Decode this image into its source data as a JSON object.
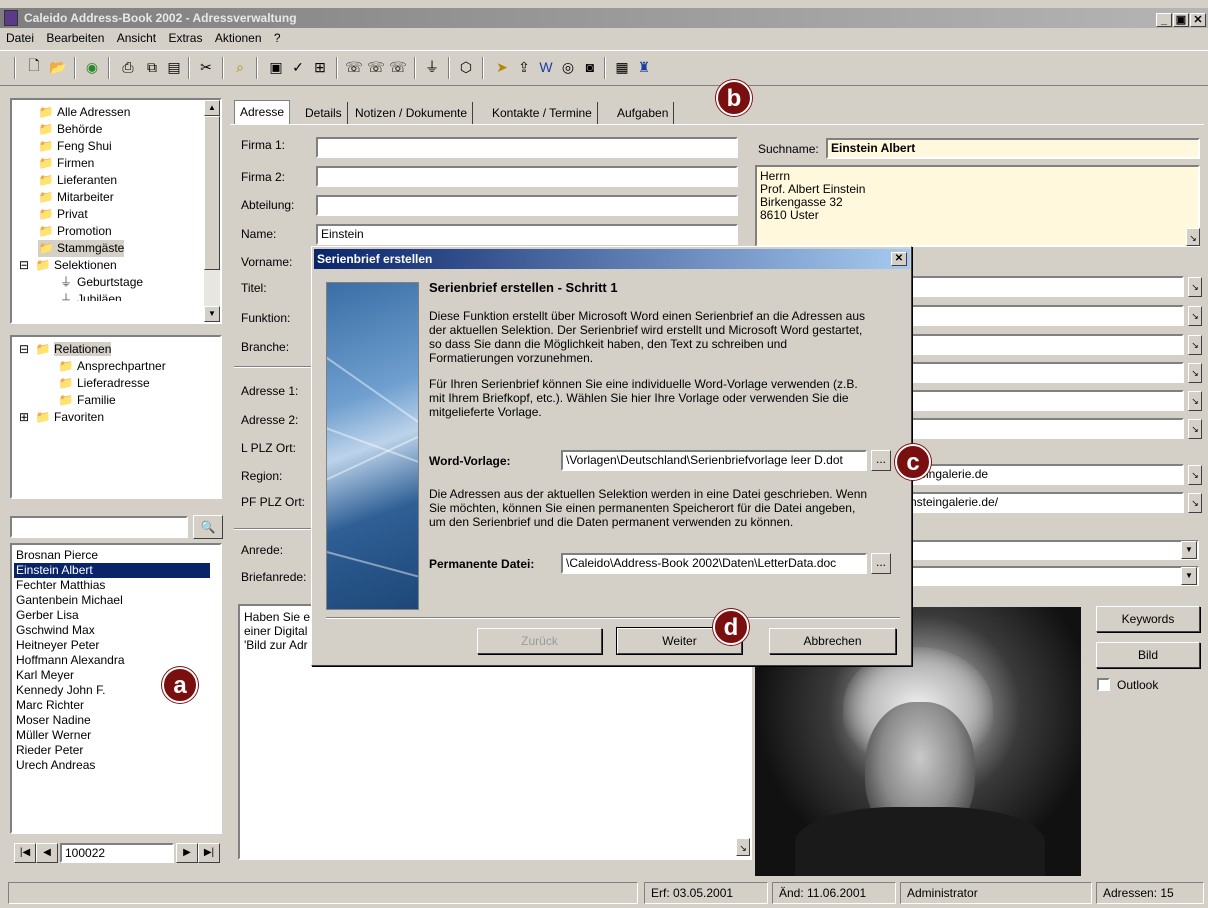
{
  "window": {
    "title": "Caleido Address-Book 2002 - Adressverwaltung"
  },
  "menu": [
    "Datei",
    "Bearbeiten",
    "Ansicht",
    "Extras",
    "Aktionen",
    "?"
  ],
  "tree_groups": {
    "items": [
      "Alle Adressen",
      "Behörde",
      "Feng Shui",
      "Firmen",
      "Lieferanten",
      "Mitarbeiter",
      "Privat",
      "Promotion",
      "Stammgäste",
      "Selektionen",
      "Geburtstage",
      "Jubiläen"
    ]
  },
  "tree_relations": {
    "items": [
      "Relationen",
      "Ansprechpartner",
      "Lieferadresse",
      "Familie",
      "Favoriten"
    ]
  },
  "search": {
    "value": ""
  },
  "contacts": {
    "items": [
      "Brosnan Pierce",
      "Einstein Albert",
      "Fechter Matthias",
      "Gantenbein Michael",
      "Gerber Lisa",
      "Gschwind Max",
      "Heitneyer Peter",
      "Hoffmann Alexandra",
      "Karl Meyer",
      "Kennedy John F.",
      "Marc Richter",
      "Moser Nadine",
      "Müller Werner",
      "Rieder Peter",
      "Urech Andreas"
    ],
    "selected": "Einstein Albert"
  },
  "navigator": {
    "record": "100022"
  },
  "tabs": [
    "Adresse",
    "Details",
    "Notizen / Dokumente",
    "Kontakte / Termine",
    "Aufgaben"
  ],
  "form": {
    "firma1_label": "Firma 1:",
    "firma2_label": "Firma 2:",
    "abteilung_label": "Abteilung:",
    "name_label": "Name:",
    "name_value": "Einstein",
    "vorname_label": "Vorname:",
    "titel_label": "Titel:",
    "funktion_label": "Funktion:",
    "branche_label": "Branche:",
    "adresse1_label": "Adresse 1:",
    "adresse2_label": "Adresse 2:",
    "lplzort_label": "L PLZ Ort:",
    "region_label": "Region:",
    "pfplzort_label": "PF PLZ Ort:",
    "anrede_label": "Anrede:",
    "briefanrede_label": "Briefanrede:",
    "suchname_label": "Suchname:",
    "suchname_value": "Einstein Albert",
    "address_block": [
      "Herrn",
      "Prof. Albert Einstein",
      "Birkengasse 32",
      "8610 Uster"
    ],
    "email_value": "steingalerie.de",
    "web_value": "nsteingalerie.de/",
    "notes_lines": [
      "Haben Sie e",
      "einer Digital",
      "'Bild zur Adr"
    ]
  },
  "side_buttons": {
    "keywords": "Keywords",
    "bild": "Bild",
    "outlook": "Outlook"
  },
  "dialog": {
    "title": "Serienbrief erstellen",
    "heading": "Serienbrief erstellen - Schritt 1",
    "para1": [
      "Diese Funktion erstellt über Microsoft Word einen Serienbrief an die Adressen aus",
      "der aktuellen Selektion. Der Serienbrief wird erstellt und Microsoft Word gestartet,",
      "so dass Sie dann die Möglichkeit haben, den Text zu schreiben und",
      "Formatierungen vorzunehmen."
    ],
    "para2": [
      "Für Ihren Serienbrief können Sie eine individuelle Word-Vorlage verwenden (z.B.",
      "mit Ihrem Briefkopf, etc.). Wählen Sie hier Ihre Vorlage oder verwenden Sie die",
      "mitgelieferte Vorlage."
    ],
    "vorlage_label": "Word-Vorlage:",
    "vorlage_value": "\\Vorlagen\\Deutschland\\Serienbriefvorlage leer D.dot",
    "para3": [
      "Die Adressen aus der aktuellen Selektion werden in eine Datei geschrieben. Wenn",
      "Sie möchten, können Sie einen permanenten Speicherort für die Datei angeben,",
      "um den Serienbrief und die Daten permanent verwenden zu können."
    ],
    "datei_label": "Permanente Datei:",
    "datei_value": "\\Caleido\\Address-Book 2002\\Daten\\LetterData.doc",
    "browse": "...",
    "back": "Zurück",
    "next": "Weiter",
    "cancel": "Abbrechen"
  },
  "status": {
    "created": "Erf: 03.05.2001",
    "changed": "Änd: 11.06.2001",
    "user": "Administrator",
    "count": "Adressen: 15"
  },
  "markers": {
    "a": "a",
    "b": "b",
    "c": "c",
    "d": "d"
  }
}
